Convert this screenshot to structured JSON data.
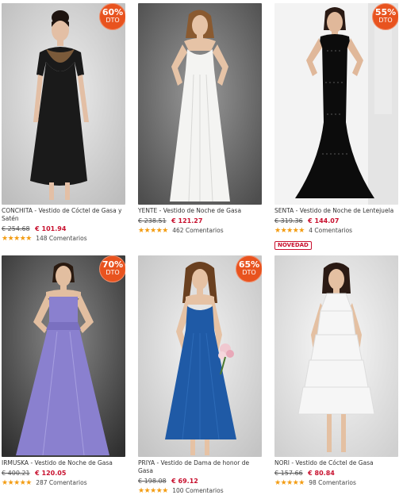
{
  "products": [
    {
      "badge_pct": "60",
      "badge_unit": "%",
      "badge_label": "DTO",
      "name": "CONCHITA - Vestido de Cóctel de Gasa y Satén",
      "old_price": "€ 254.68",
      "new_price": "€ 101.94",
      "stars": "★★★★★",
      "reviews": "148 Comentarios",
      "tag": ""
    },
    {
      "badge_pct": "",
      "badge_unit": "",
      "badge_label": "",
      "name": "YENTE - Vestido de Noche de Gasa",
      "old_price": "€ 238.51",
      "new_price": "€ 121.27",
      "stars": "★★★★★",
      "reviews": "462 Comentarios",
      "tag": ""
    },
    {
      "badge_pct": "55",
      "badge_unit": "%",
      "badge_label": "DTO",
      "name": "SENTA - Vestido de Noche de Lentejuela",
      "old_price": "€ 319.36",
      "new_price": "€ 144.07",
      "stars": "★★★★★",
      "reviews": "4 Comentarios",
      "tag": "NOVEDAD"
    },
    {
      "badge_pct": "70",
      "badge_unit": "%",
      "badge_label": "DTO",
      "name": "IRMUSKA - Vestido de Noche de Gasa",
      "old_price": "€ 400.21",
      "new_price": "€ 120.05",
      "stars": "★★★★★",
      "reviews": "287 Comentarios",
      "tag": ""
    },
    {
      "badge_pct": "65",
      "badge_unit": "%",
      "badge_label": "DTO",
      "name": "PRIYA - Vestido de Dama de honor de Gasa",
      "old_price": "€ 198.08",
      "new_price": "€ 69.12",
      "stars": "★★★★★",
      "reviews": "100 Comentarios",
      "tag": ""
    },
    {
      "badge_pct": "",
      "badge_unit": "",
      "badge_label": "",
      "name": "NORI - Vestido de Cóctel de Gasa",
      "old_price": "€ 157.66",
      "new_price": "€ 80.84",
      "stars": "★★★★★",
      "reviews": "98 Comentarios",
      "tag": ""
    }
  ],
  "colors": {
    "badge": "#e8531f",
    "sale_price": "#c8102e",
    "stars": "#f39c12",
    "dress_black": "#1a1a1a",
    "dress_white": "#f4f4f2",
    "dress_sequin": "#0c0c0c",
    "dress_lavender": "#8a80cf",
    "dress_blue": "#1f5aa6",
    "dress_ruffle": "#f6f6f6"
  }
}
